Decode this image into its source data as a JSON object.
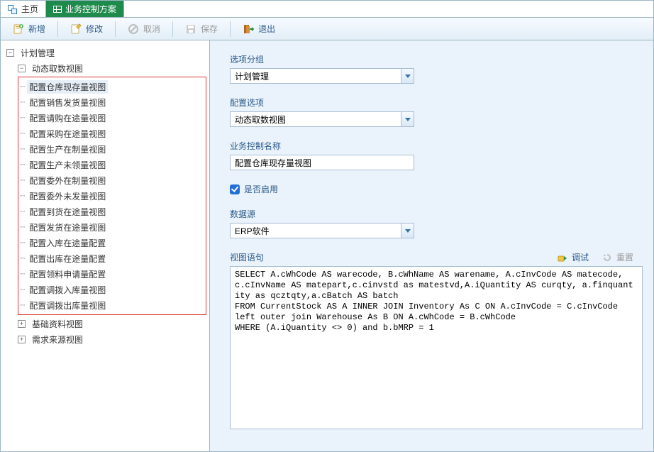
{
  "tabs": {
    "home": "主页",
    "active": "业务控制方案"
  },
  "toolbar": {
    "new": "新增",
    "edit": "修改",
    "cancel": "取消",
    "save": "保存",
    "exit": "退出"
  },
  "tree": {
    "root": "计划管理",
    "dyn": "动态取数视图",
    "dyn_items": [
      "配置仓库现存量视图",
      "配置销售发货量视图",
      "配置请购在途量视图",
      "配置采购在途量视图",
      "配置生产在制量视图",
      "配置生产未领量视图",
      "配置委外在制量视图",
      "配置委外未发量视图",
      "配置到货在途量视图",
      "配置发货在途量视图",
      "配置入库在途量配置",
      "配置出库在途量配置",
      "配置领料申请量配置",
      "配置调拨入库量视图",
      "配置调拨出库量视图"
    ],
    "base": "基础资料视图",
    "demand": "需求来源视图"
  },
  "form": {
    "group_label": "选项分组",
    "group_value": "计划管理",
    "option_label": "配置选项",
    "option_value": "动态取数视图",
    "name_label": "业务控制名称",
    "name_value": "配置仓库现存量视图",
    "enable_label": "是否启用",
    "ds_label": "数据源",
    "ds_value": "ERP软件",
    "sql_label": "视图语句",
    "debug": "调试",
    "reset": "重置",
    "sql_value": "SELECT A.cWhCode AS warecode, B.cWhName AS warename, A.cInvCode AS matecode, c.cInvName AS matepart,c.cinvstd as matestvd,A.iQuantity AS curqty, a.finquantity as qcztqty,a.cBatch AS batch\nFROM CurrentStock AS A INNER JOIN Inventory As C ON A.cInvCode = C.cInvCode\nleft outer join Warehouse As B ON A.cWhCode = B.cWhCode\nWHERE (A.iQuantity <> 0) and b.bMRP = 1"
  }
}
